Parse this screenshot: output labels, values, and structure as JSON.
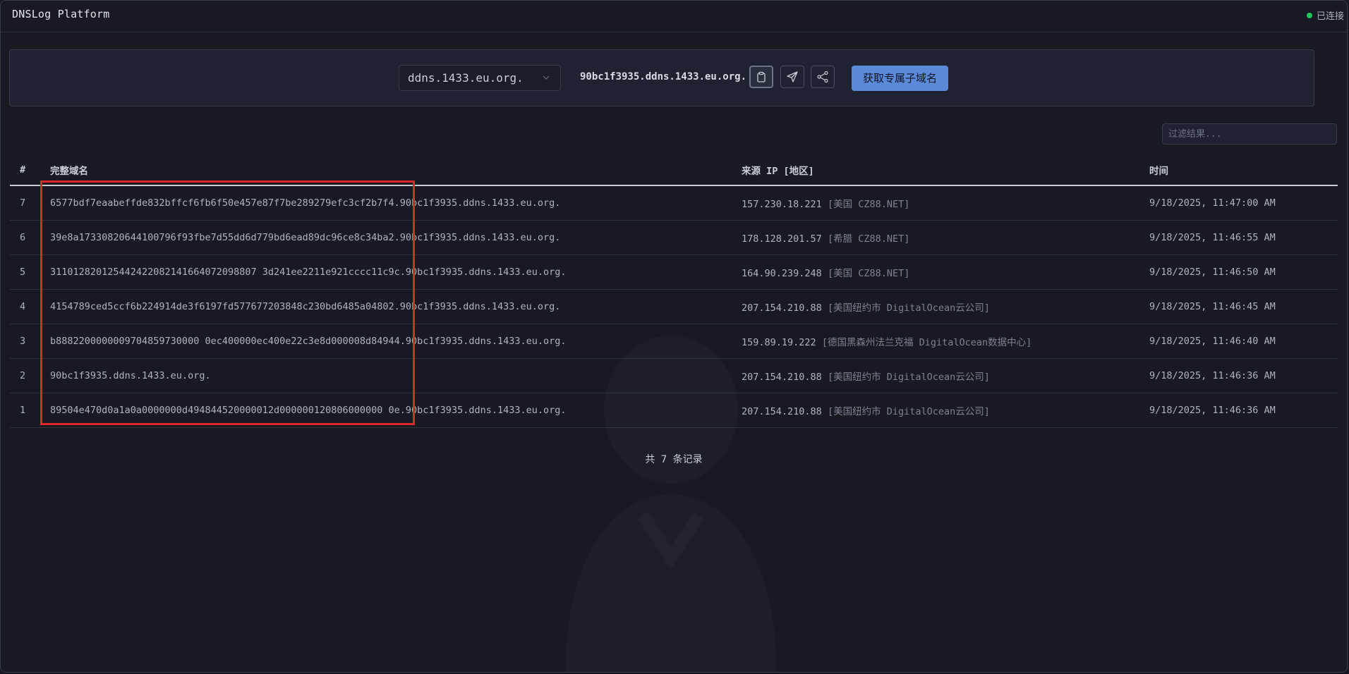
{
  "app": {
    "title": "DNSLog Platform",
    "status": "已连接"
  },
  "panel": {
    "domain_select": "ddns.1433.eu.org.",
    "subdomain": "90bc1f3935.ddns.1433.eu.org.",
    "get_button": "获取专属子域名"
  },
  "filter": {
    "placeholder": "过滤结果..."
  },
  "table": {
    "headers": [
      "#",
      "完整域名",
      "来源 IP [地区]",
      "时间"
    ],
    "rows": [
      {
        "idx": "7",
        "domain": "6577bdf7eaabeffde832bffcf6fb6f50e457e87f7be289279efc3cf2b7f4.90bc1f3935.ddns.1433.eu.org.",
        "ip": "157.230.18.221",
        "region": "[美国 CZ88.NET]",
        "time": "9/18/2025, 11:47:00 AM"
      },
      {
        "idx": "6",
        "domain": "39e8a17330820644100796f93fbe7d55dd6d779bd6ead89dc96ce8c34ba2.90bc1f3935.ddns.1433.eu.org.",
        "ip": "178.128.201.57",
        "region": "[希腊 CZ88.NET]",
        "time": "9/18/2025, 11:46:55 AM"
      },
      {
        "idx": "5",
        "domain": "311012820125442422082141664072098807 3d241ee2211e921cccc11c9c.90bc1f3935.ddns.1433.eu.org.",
        "ip": "164.90.239.248",
        "region": "[美国 CZ88.NET]",
        "time": "9/18/2025, 11:46:50 AM"
      },
      {
        "idx": "4",
        "domain": "4154789ced5ccf6b224914de3f6197fd577677203848c230bd6485a04802.90bc1f3935.ddns.1433.eu.org.",
        "ip": "207.154.210.88",
        "region": "[美国纽约市 DigitalOcean云公司]",
        "time": "9/18/2025, 11:46:45 AM"
      },
      {
        "idx": "3",
        "domain": "b8882200000009704859730000 0ec400000ec400e22c3e8d000008d84944.90bc1f3935.ddns.1433.eu.org.",
        "ip": "159.89.19.222",
        "region": "[德国黑森州法兰克福 DigitalOcean数据中心]",
        "time": "9/18/2025, 11:46:40 AM"
      },
      {
        "idx": "2",
        "domain": "90bc1f3935.ddns.1433.eu.org.",
        "ip": "207.154.210.88",
        "region": "[美国纽约市 DigitalOcean云公司]",
        "time": "9/18/2025, 11:46:36 AM"
      },
      {
        "idx": "1",
        "domain": "89504e470d0a1a0a0000000d494844520000012d000000120806000000 0e.90bc1f3935.ddns.1433.eu.org.",
        "ip": "207.154.210.88",
        "region": "[美国纽约市 DigitalOcean云公司]",
        "time": "9/18/2025, 11:46:36 AM"
      }
    ]
  },
  "footer": {
    "total": "共 7 条记录"
  },
  "colors": {
    "accent": "#5b8ad9",
    "highlight": "#e3262a",
    "status": "#22c55e"
  }
}
